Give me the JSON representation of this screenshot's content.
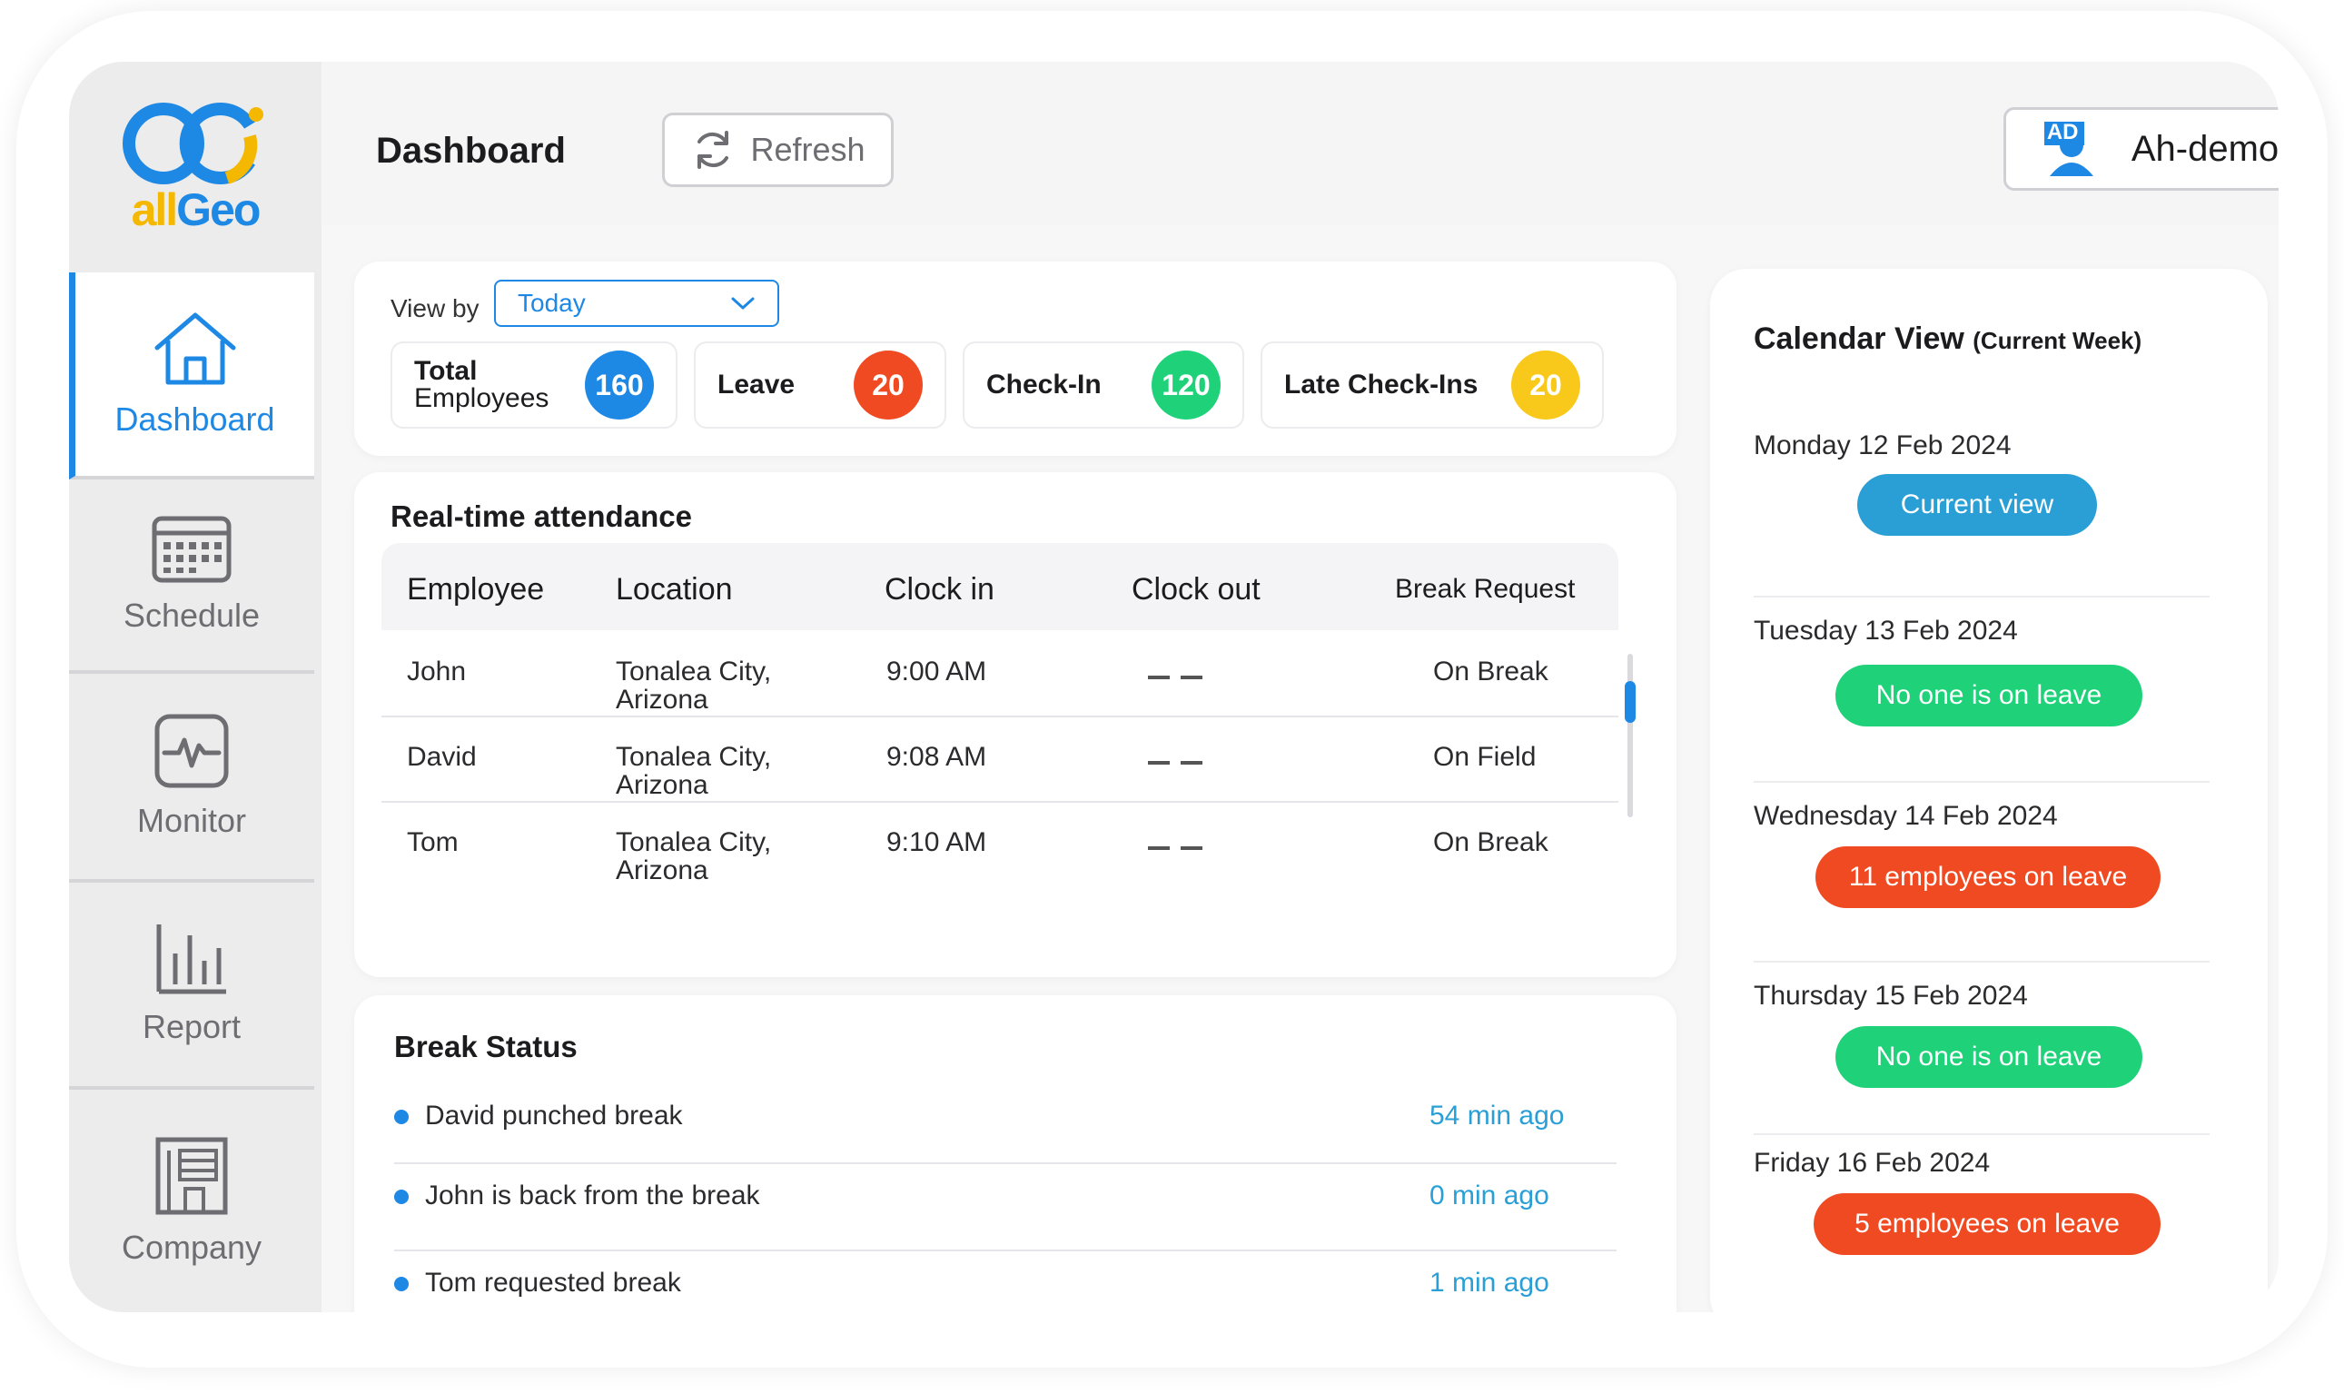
{
  "brand": {
    "name_part1": "all",
    "name_part2": "Geo",
    "colors": {
      "blue": "#1e88e5",
      "yellow": "#f5b800"
    }
  },
  "sidebar": {
    "items": [
      {
        "label": "Dashboard",
        "icon": "home-icon",
        "active": true
      },
      {
        "label": "Schedule",
        "icon": "calendar-icon",
        "active": false
      },
      {
        "label": "Monitor",
        "icon": "monitor-icon",
        "active": false
      },
      {
        "label": "Report",
        "icon": "bar-chart-icon",
        "active": false
      },
      {
        "label": "Company",
        "icon": "building-icon",
        "active": false
      }
    ]
  },
  "header": {
    "title": "Dashboard",
    "refresh_label": "Refresh",
    "user_badge": "AD",
    "user_name": "Ah-demo"
  },
  "filters": {
    "view_by_label": "View by",
    "view_by_value": "Today"
  },
  "stats": [
    {
      "label_line1": "Total",
      "label_line2": "Employees",
      "value": "160",
      "color": "#1e88e5"
    },
    {
      "label_line1": "Leave",
      "label_line2": "",
      "value": "20",
      "color": "#f04a23"
    },
    {
      "label_line1": "Check-In",
      "label_line2": "",
      "value": "120",
      "color": "#1fd27a"
    },
    {
      "label_line1": "Late Check-Ins",
      "label_line2": "",
      "value": "20",
      "color": "#f8c91a"
    }
  ],
  "attendance": {
    "title": "Real-time attendance",
    "columns": [
      "Employee",
      "Location",
      "Clock in",
      "Clock out",
      "Break Request"
    ],
    "rows": [
      {
        "employee": "John",
        "location_line1": "Tonalea City,",
        "location_line2": "Arizona",
        "clock_in": "9:00 AM",
        "clock_out": "— —",
        "break_request": "On Break"
      },
      {
        "employee": "David",
        "location_line1": "Tonalea City,",
        "location_line2": "Arizona",
        "clock_in": "9:08 AM",
        "clock_out": "— —",
        "break_request": "On Field"
      },
      {
        "employee": "Tom",
        "location_line1": "Tonalea City,",
        "location_line2": "Arizona",
        "clock_in": "9:10 AM",
        "clock_out": "— —",
        "break_request": "On Break"
      }
    ]
  },
  "break_status": {
    "title": "Break Status",
    "items": [
      {
        "text": "David punched break",
        "time": "54 min ago"
      },
      {
        "text": "John is back from the break",
        "time": "0 min ago"
      },
      {
        "text": "Tom requested break",
        "time": "1 min ago"
      }
    ]
  },
  "calendar": {
    "title": "Calendar View",
    "subtitle": "(Current Week)",
    "days": [
      {
        "date": "Monday 12 Feb 2024",
        "status": "Current view",
        "color": "#2a9fd6"
      },
      {
        "date": "Tuesday 13 Feb 2024",
        "status": "No one is on leave",
        "color": "#1fd27a"
      },
      {
        "date": "Wednesday 14 Feb 2024",
        "status": "11 employees on leave",
        "color": "#f04a23"
      },
      {
        "date": "Thursday 15 Feb 2024",
        "status": "No one is on leave",
        "color": "#1fd27a"
      },
      {
        "date": "Friday 16 Feb 2024",
        "status": "5 employees on leave",
        "color": "#f04a23"
      }
    ]
  }
}
